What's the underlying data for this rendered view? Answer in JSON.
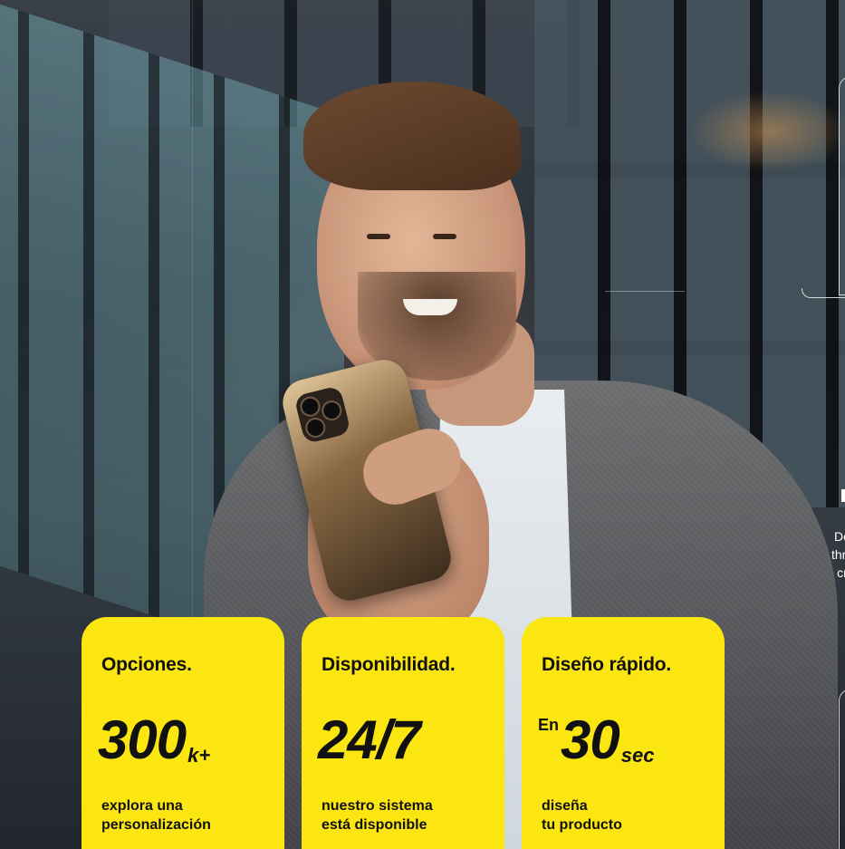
{
  "stats": [
    {
      "title": "Opciones.",
      "prefix": "",
      "value": "300",
      "suffix": "k+",
      "description_lines": [
        "explora una",
        "personalización"
      ]
    },
    {
      "title": "Disponibilidad.",
      "prefix": "",
      "value": "24/7",
      "suffix": "",
      "description_lines": [
        "nuestro sistema",
        "está disponible"
      ]
    },
    {
      "title": "Diseño rápido.",
      "prefix": "En",
      "value": "30",
      "suffix": "sec",
      "description_lines": [
        "diseña",
        "tu producto"
      ]
    }
  ],
  "side_text_fragments": [
    "De",
    "thre",
    "cr"
  ],
  "colors": {
    "card_background": "#fbe611",
    "card_text": "#111111",
    "side_text": "#ffffff"
  },
  "icons": {
    "right_frame": "outline-frame-icon",
    "right_frame_lower": "outline-frame-icon"
  }
}
